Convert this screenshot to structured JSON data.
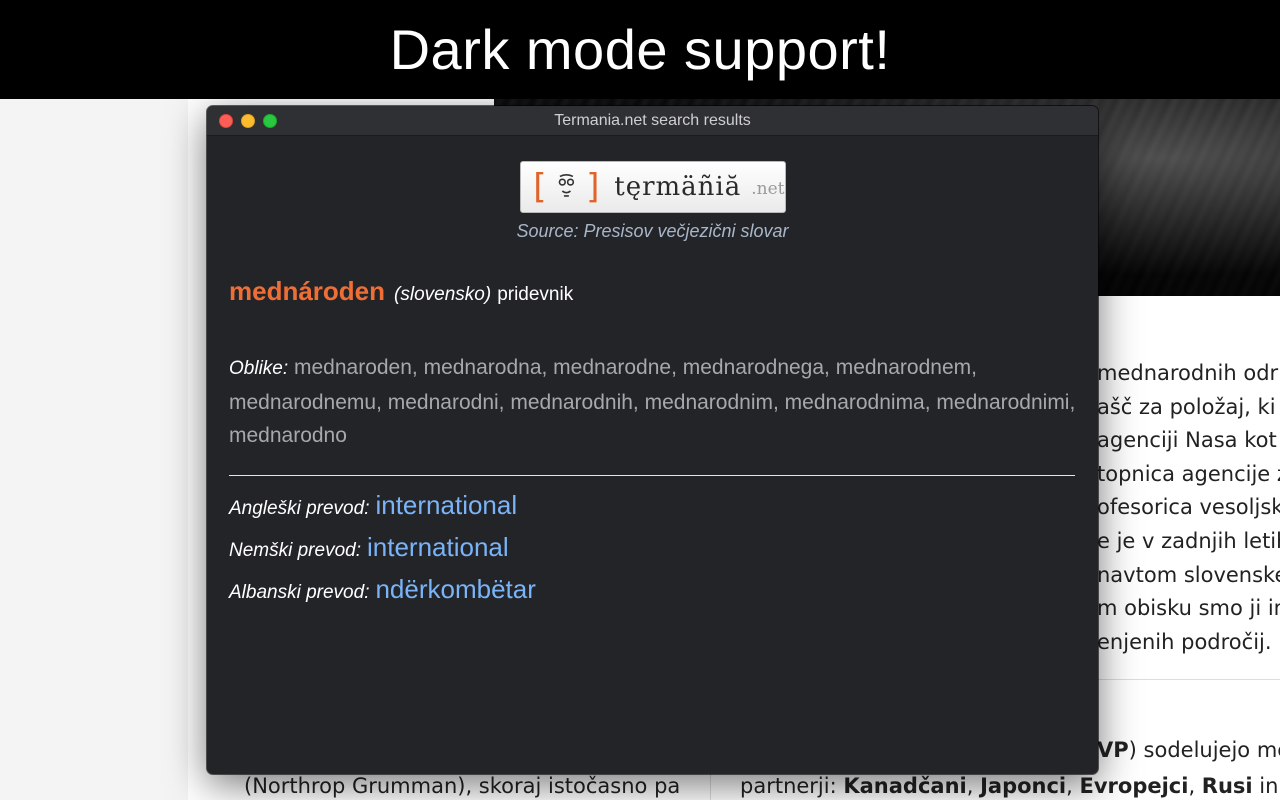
{
  "banner": {
    "text": "Dark mode support!"
  },
  "window": {
    "title": "Termania.net search results",
    "logo": {
      "brand": "tęrmäñiă",
      "domain": ".net"
    },
    "source": "Source: Presisov večjezični slovar",
    "entry": {
      "headword": "mednároden",
      "language": "(slovensko)",
      "part_of_speech": "pridevnik"
    },
    "forms": {
      "label": "Oblike:",
      "text": "mednaroden, mednarodna, mednarodne, mednarodnega, mednarodnem, mednarodnemu, mednarodni, mednarodnih, mednarodnim, mednarodnima, mednarodnimi, mednarodno"
    },
    "translations": [
      {
        "label": "Angleški prevod:",
        "value": "international"
      },
      {
        "label": "Nemški prevod:",
        "value": "international"
      },
      {
        "label": "Albanski prevod:",
        "value": "ndërkombëtar"
      }
    ]
  },
  "background_page": {
    "article_fragments": [
      "mednarodnih odr",
      "ašč za položaj, ki g",
      "agenciji Nasa kot s",
      "topnica agencije z",
      "ofesorica vesoljsk",
      "e je v zadnjih letih",
      "navtom slovenskeg",
      "m obisku smo ji im",
      "enjenih področij."
    ],
    "bottom_right_text": "VP) sodelujejo me",
    "bottom_right_bold": "VP",
    "bottom_right_rest": ") sodelujejo me",
    "partners_prefix": "partnerji: ",
    "partners": [
      "Kanadčani",
      "Japonci",
      "Evropejci",
      "Rusi"
    ],
    "partners_suffix": " in sev",
    "bottom_left_text": "(Northrop Grumman), skoraj istočasno pa"
  }
}
